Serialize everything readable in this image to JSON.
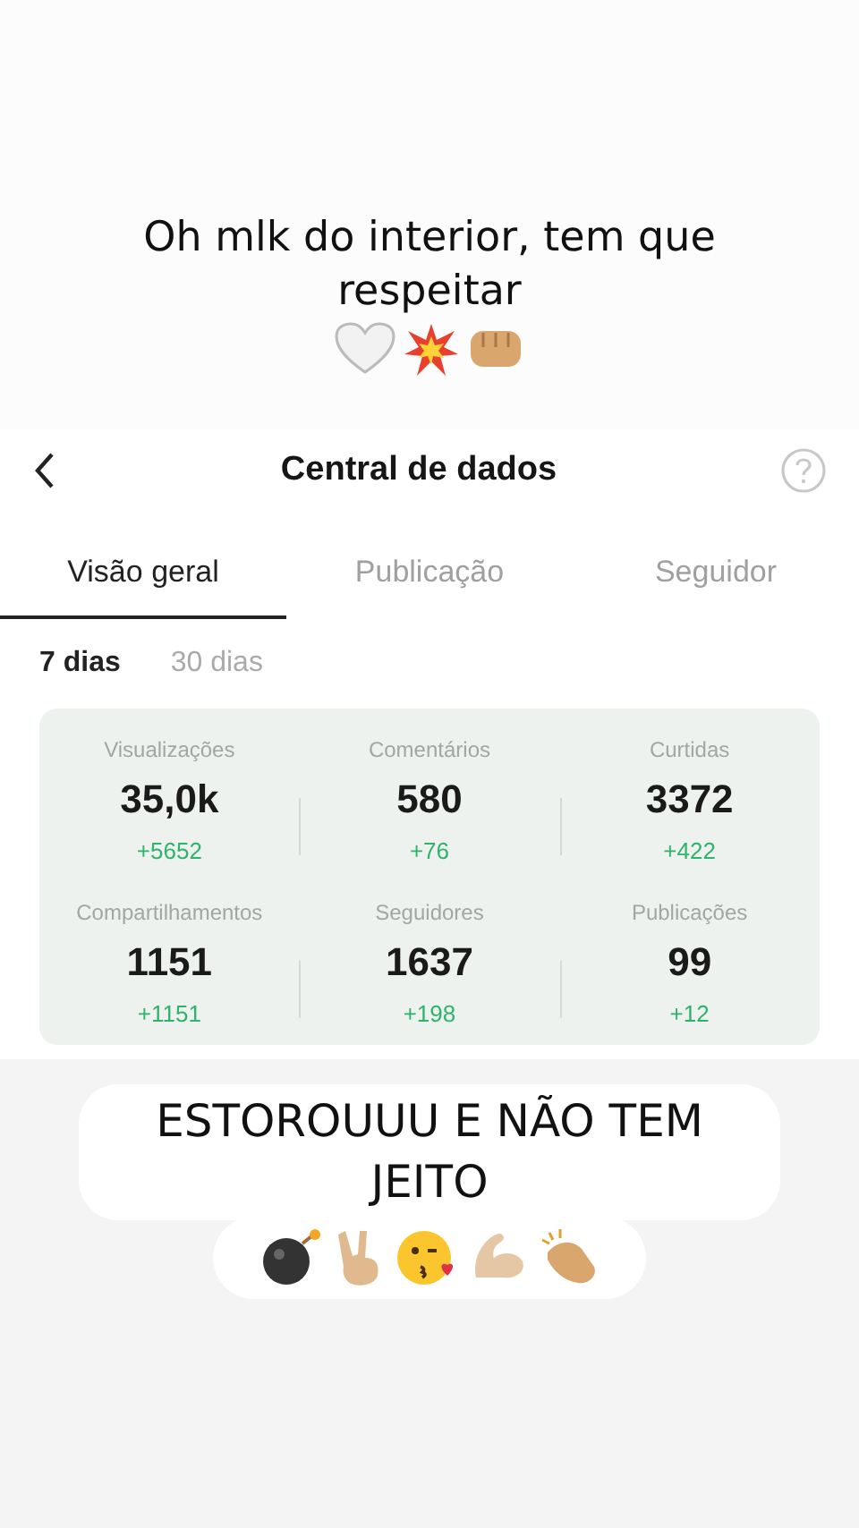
{
  "caption_top": "Oh mlk do interior, tem que respeitar",
  "header": {
    "title": "Central de dados"
  },
  "tabs": [
    {
      "label": "Visão geral",
      "selected": true
    },
    {
      "label": "Publicação",
      "selected": false
    },
    {
      "label": "Seguidor",
      "selected": false
    }
  ],
  "periods": [
    {
      "label": "7 dias",
      "selected": true
    },
    {
      "label": "30 dias",
      "selected": false
    }
  ],
  "metrics": [
    {
      "label": "Visualizações",
      "value": "35,0k",
      "change": "+5652"
    },
    {
      "label": "Comentários",
      "value": "580",
      "change": "+76"
    },
    {
      "label": "Curtidas",
      "value": "3372",
      "change": "+422"
    },
    {
      "label": "Compartilhamentos",
      "value": "1151",
      "change": "+1151"
    },
    {
      "label": "Seguidores",
      "value": "1637",
      "change": "+198"
    },
    {
      "label": "Publicações",
      "value": "99",
      "change": "+12"
    }
  ],
  "caption_bottom": "ESTOROUUU E NÃO TEM JEITO"
}
